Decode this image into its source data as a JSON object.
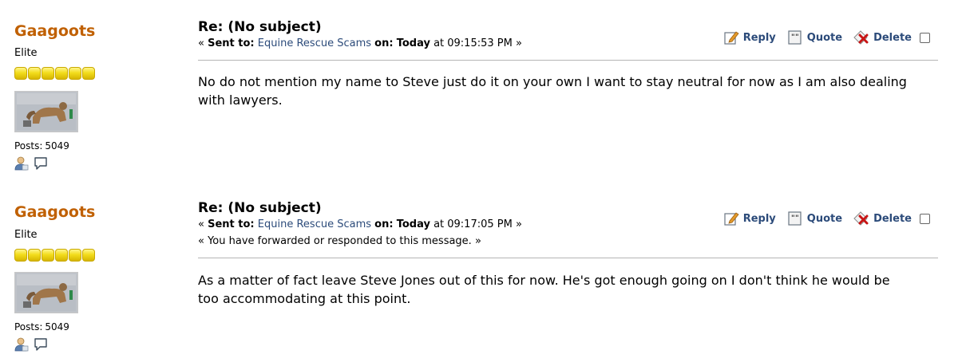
{
  "colors": {
    "poster_name": "#c06002",
    "link": "#2c4b7a",
    "divider": "#b5b5b5",
    "star": "#f3dd1d"
  },
  "messages": [
    {
      "poster": {
        "name": "Gaagoots",
        "group": "Elite",
        "stars": 6,
        "posts_label": "Posts:",
        "posts_count": "5049"
      },
      "subject": "Re: (No subject)",
      "meta": {
        "prefix": "«",
        "sent_to_label": "Sent to:",
        "recipient": "Equine Rescue Scams",
        "on_label": "on:",
        "day": "Today",
        "at_text": "at 09:15:53 PM",
        "suffix": "»"
      },
      "notice": "",
      "actions": {
        "reply": "Reply",
        "quote": "Quote",
        "delete": "Delete"
      },
      "body": "No do not mention my name to Steve just do it on your own I want to stay neutral for now as I am also dealing with lawyers."
    },
    {
      "poster": {
        "name": "Gaagoots",
        "group": "Elite",
        "stars": 6,
        "posts_label": "Posts:",
        "posts_count": "5049"
      },
      "subject": "Re: (No subject)",
      "meta": {
        "prefix": "«",
        "sent_to_label": "Sent to:",
        "recipient": "Equine Rescue Scams",
        "on_label": "on:",
        "day": "Today",
        "at_text": "at 09:17:05 PM",
        "suffix": "»"
      },
      "notice": "« You have forwarded or responded to this message. »",
      "actions": {
        "reply": "Reply",
        "quote": "Quote",
        "delete": "Delete"
      },
      "body": "As a matter of fact leave Steve Jones out of this for now. He's got enough going on I don't think he would be too accommodating at this point."
    }
  ]
}
